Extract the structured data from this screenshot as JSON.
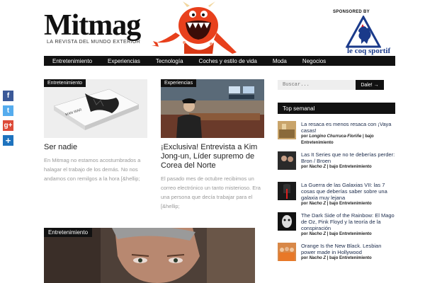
{
  "header": {
    "logo_title": "Mitmag",
    "logo_tagline": "LA REVISTA DEL MUNDO EXTERIOR",
    "sponsor_label": "SPONSORED BY",
    "sponsor_name": "le coq sportif"
  },
  "nav": {
    "items": [
      {
        "label": "Entretenimiento"
      },
      {
        "label": "Experiencias"
      },
      {
        "label": "Tecnología"
      },
      {
        "label": "Coches y estilo de vida"
      },
      {
        "label": "Moda"
      },
      {
        "label": "Negocios"
      }
    ]
  },
  "share": {
    "facebook": "f",
    "twitter": "t",
    "googleplus": "g+",
    "more": "+"
  },
  "articles": [
    {
      "category": "Entretenimiento",
      "title": "Ser nadie",
      "excerpt": "En Mitmag no estamos acostumbrados a halagar el trabajo de los demás. No nos andamos con remilgos a la hora [&hellip;",
      "book_cover_text": "MAN WAR"
    },
    {
      "category": "Experiencias",
      "title": "¡Exclusiva! Entrevista a Kim Jong-un, Líder supremo de Corea del Norte",
      "excerpt": "El pasado mes de octubre recibimos un correo electrónico un tanto misterioso. Era una persona que decía trabajar para el [&hellip;"
    }
  ],
  "featured": {
    "category": "Entretenimiento"
  },
  "search": {
    "placeholder": "Buscar...",
    "button_label": "Dale! →"
  },
  "top_semanal": {
    "heading": "Top semanal",
    "items": [
      {
        "title": "La resaca es menos resaca con ¡Vaya casas!",
        "author": "Longino Churruca-Floriñe",
        "category": "Entretenimiento",
        "by": "por",
        "sep": "| bajo"
      },
      {
        "title": "Las It Series que no te deberías perder: Bron / Broen",
        "author": "Nacho Z",
        "category": "Entretenimiento",
        "by": "por",
        "sep": "| bajo"
      },
      {
        "title": "La Guerra de las Galaxias VII: las 7 cosas que deberías saber sobre una galaxia muy lejana",
        "author": "Nacho Z",
        "category": "Entretenimiento",
        "by": "por",
        "sep": "| bajo"
      },
      {
        "title": "The Dark Side of the Rainbow: El Mago de Oz, Pink Floyd y la teoría de la conspiración",
        "author": "Nacho Z",
        "category": "Entretenimiento",
        "by": "por",
        "sep": "| bajo"
      },
      {
        "title": "Orange Is the New Black. Lesbian power made in Hollywood",
        "author": "Nacho Z",
        "category": "Entretenimiento",
        "by": "por",
        "sep": "| bajo"
      }
    ]
  },
  "colors": {
    "nav_bg": "#111111",
    "monster": "#e8401c",
    "sponsor_blue": "#1a3a8a",
    "facebook": "#3b5998",
    "twitter": "#55acee",
    "googleplus": "#dd4b39",
    "share": "#1e73be"
  }
}
